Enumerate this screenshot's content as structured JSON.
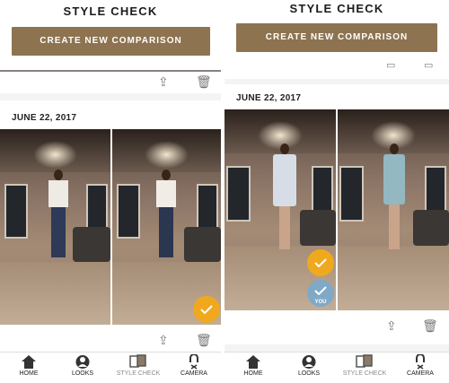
{
  "left": {
    "title": "STYLE CHECK",
    "cta_label": "CREATE NEW COMPARISON",
    "date": "JUNE 22, 2017"
  },
  "right": {
    "title": "STYLE CHECK",
    "cta_label": "CREATE NEW COMPARISON",
    "date": "JUNE 22, 2017",
    "you_label": "YOU"
  },
  "tabs": [
    {
      "label": "HOME",
      "icon": "home-icon"
    },
    {
      "label": "LOOKS",
      "icon": "looks-icon"
    },
    {
      "label": "STYLE CHECK",
      "icon": "style-check-icon"
    },
    {
      "label": "CAMERA",
      "icon": "camera-icon"
    }
  ],
  "colors": {
    "accent_brown": "#8d7350",
    "check_orange": "#f0a91e",
    "check_blue": "#7fa9c7"
  }
}
